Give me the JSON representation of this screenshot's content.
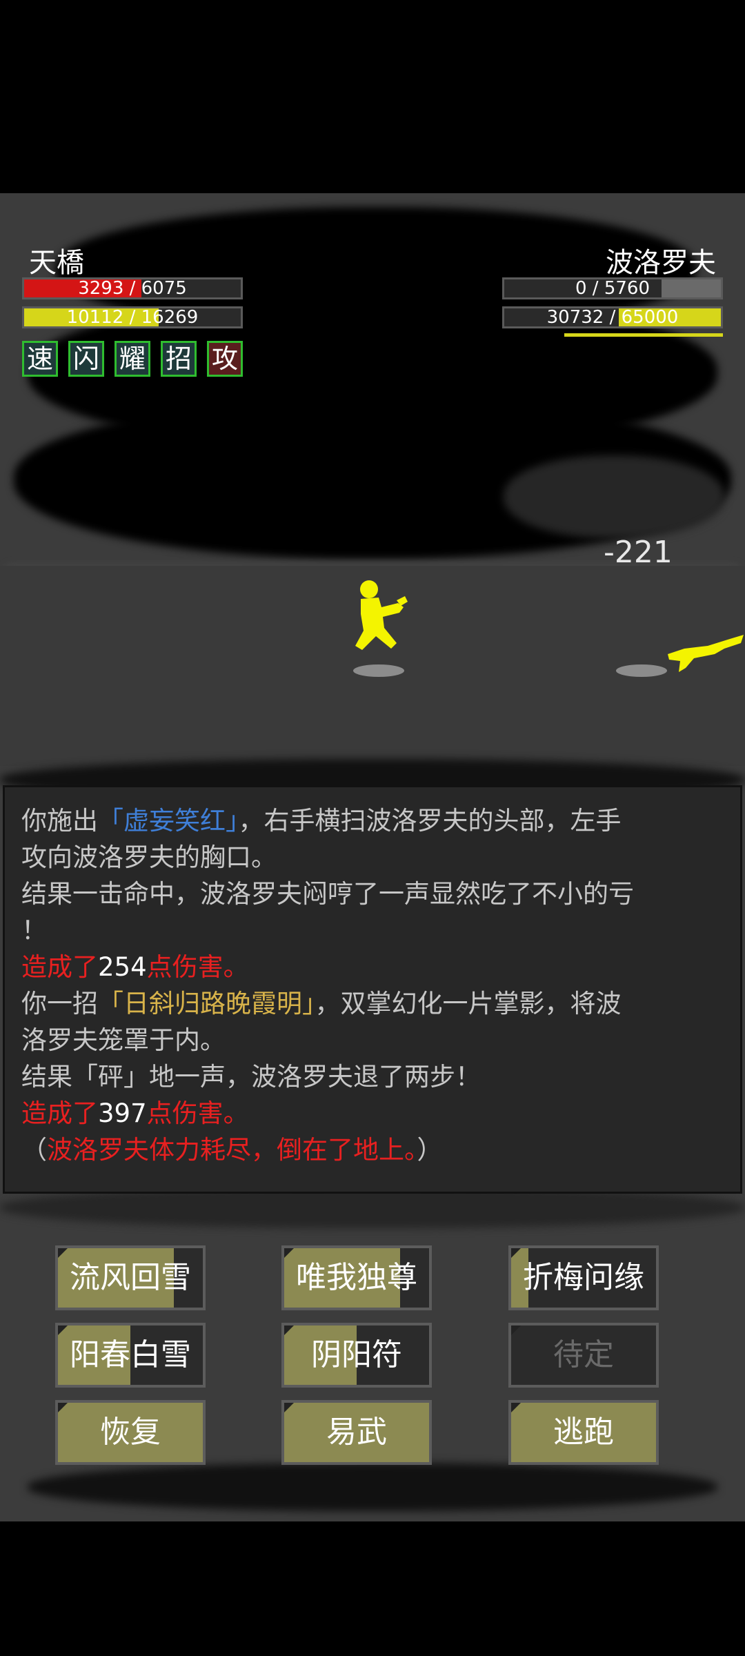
{
  "player": {
    "name": "天橋",
    "hp": {
      "text": "3293 / 6075",
      "fraction": 0.542,
      "color": "#d41515"
    },
    "mp": {
      "text": "10112 / 16269",
      "fraction": 0.62,
      "color": "#d6d61a"
    },
    "skills": [
      {
        "char": "速",
        "bg": "#1e3a3a"
      },
      {
        "char": "闪",
        "bg": "#1e3a3a"
      },
      {
        "char": "耀",
        "bg": "#1e3a3a"
      },
      {
        "char": "招",
        "bg": "#1e3a3a"
      },
      {
        "char": "攻",
        "bg": "#5a1e1e"
      }
    ]
  },
  "enemy": {
    "name": "波洛罗夫",
    "hp": {
      "text": "0 / 5760",
      "fraction": 0.0
    },
    "mp": {
      "text": "30732 / 65000",
      "fraction": 0.47,
      "color": "#d6d61a"
    }
  },
  "damage_popup": "-221",
  "log": {
    "lines": [
      [
        {
          "t": "你施出",
          "c": ""
        },
        {
          "t": "「虚妄笑红」",
          "c": "blue"
        },
        {
          "t": "，右手横扫波洛罗夫的头部，左手",
          "c": ""
        }
      ],
      [
        {
          "t": "攻向波洛罗夫的胸口。",
          "c": ""
        }
      ],
      [
        {
          "t": "结果一击命中，波洛罗夫闷哼了一声显然吃了不小的亏",
          "c": ""
        }
      ],
      [
        {
          "t": "！",
          "c": ""
        }
      ],
      [
        {
          "t": "造成了",
          "c": "red"
        },
        {
          "t": "254",
          "c": "white"
        },
        {
          "t": "点伤害。",
          "c": "red"
        }
      ],
      [
        {
          "t": "你一招",
          "c": ""
        },
        {
          "t": "「日斜归路晚霞明」",
          "c": "gold"
        },
        {
          "t": "，双掌幻化一片掌影，将波",
          "c": ""
        }
      ],
      [
        {
          "t": "洛罗夫笼罩于内。",
          "c": ""
        }
      ],
      [
        {
          "t": "结果「砰」地一声，波洛罗夫退了两步！",
          "c": ""
        }
      ],
      [
        {
          "t": "造成了",
          "c": "red"
        },
        {
          "t": "397",
          "c": "white"
        },
        {
          "t": "点伤害。",
          "c": "red"
        }
      ],
      [
        {
          "t": "（",
          "c": ""
        },
        {
          "t": "波洛罗夫体力耗尽，倒在了地上。",
          "c": "red"
        },
        {
          "t": "）",
          "c": ""
        }
      ]
    ]
  },
  "buttons": [
    {
      "label": "流风回雪",
      "fill": 0.8
    },
    {
      "label": "唯我独尊",
      "fill": 0.8
    },
    {
      "label": "折梅问缘",
      "fill": 0.12
    },
    {
      "label": "阳春白雪",
      "fill": 0.5
    },
    {
      "label": "阴阳符",
      "fill": 0.5
    },
    {
      "label": "待定",
      "fill": 0.0
    },
    {
      "label": "恢复",
      "fill": 1.0
    },
    {
      "label": "易武",
      "fill": 1.0
    },
    {
      "label": "逃跑",
      "fill": 1.0
    }
  ]
}
